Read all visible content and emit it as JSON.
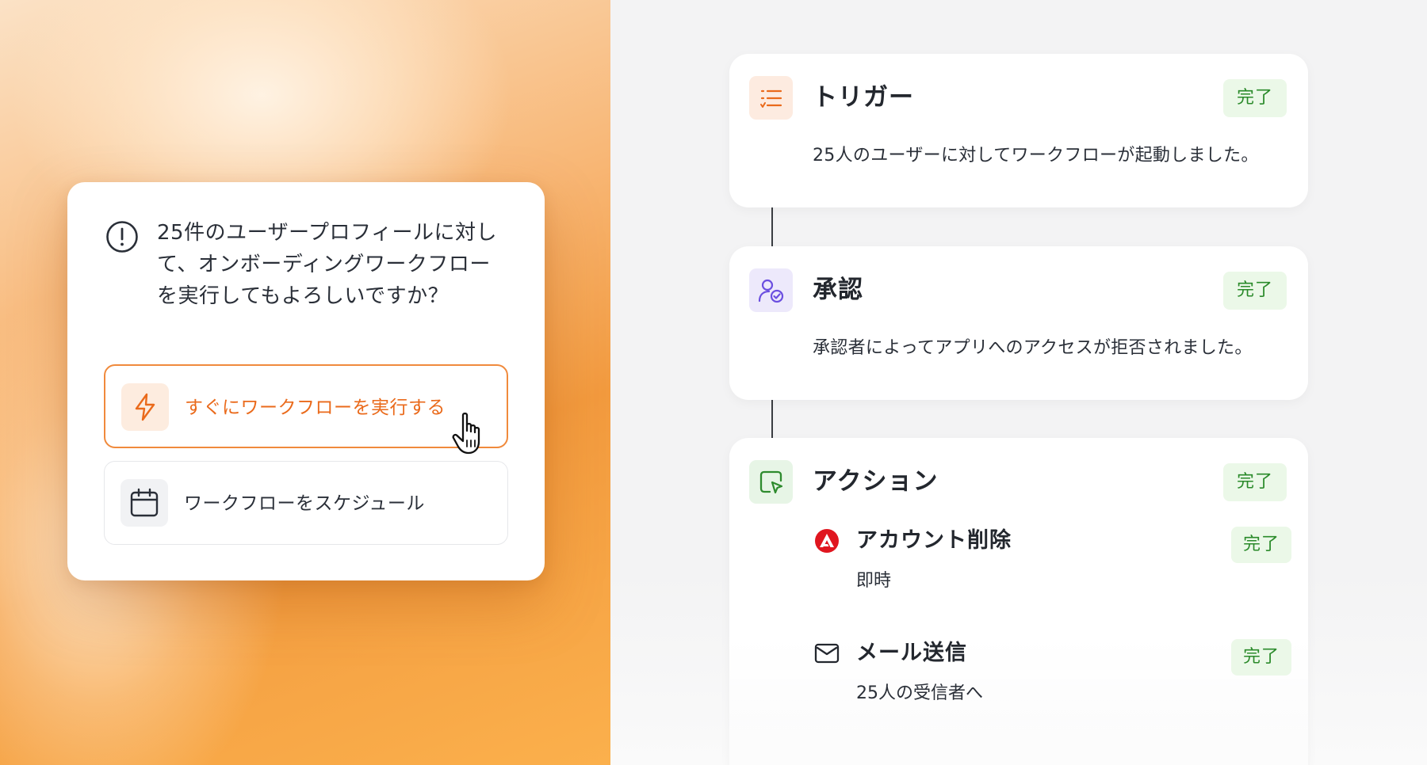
{
  "confirm_dialog": {
    "icon": "exclamation-circle-icon",
    "message": "25件のユーザープロフィールに対して、オンボーディングワークフローを実行してもよろしいですか？",
    "options": [
      {
        "label": "すぐにワークフローを実行する",
        "icon": "lightning-icon",
        "accent": "#ea6a1b"
      },
      {
        "label": "ワークフローをスケジュール",
        "icon": "calendar-icon"
      }
    ]
  },
  "workflow": {
    "steps": [
      {
        "title": "トリガー",
        "status": "完了",
        "description": "25人のユーザーに対してワークフローが起動しました。",
        "icon": "list-icon"
      },
      {
        "title": "承認",
        "status": "完了",
        "description": "承認者によってアプリへのアクセスが拒否されました。",
        "icon": "user-check-icon"
      },
      {
        "title": "アクション",
        "status": "完了",
        "icon": "cursor-window-icon",
        "sub_actions": [
          {
            "title": "アカウント削除",
            "status": "完了",
            "description": "即時",
            "icon": "adobe-logo-icon"
          },
          {
            "title": "メール送信",
            "status": "完了",
            "description": "25人の受信者へ",
            "icon": "envelope-icon"
          }
        ]
      }
    ]
  },
  "colors": {
    "accent_orange": "#ea6a1b",
    "status_green": "#2a8a2a",
    "status_green_bg": "#ebf8e8"
  }
}
